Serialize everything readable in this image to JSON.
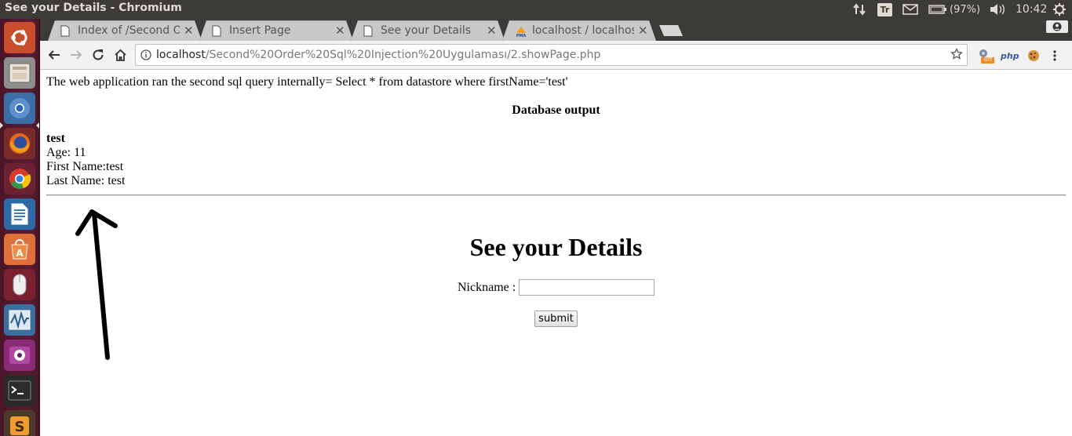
{
  "window": {
    "title": "See your Details - Chromium"
  },
  "system_tray": {
    "keyboard_indicator": "Tr",
    "battery": "(97%)",
    "clock": "10:42"
  },
  "launcher": {
    "items": [
      "ubuntu-logo-icon",
      "files-icon",
      "chromium-icon",
      "firefox-icon",
      "chrome-icon",
      "libreoffice-writer-icon",
      "software-center-icon",
      "mouse-settings-icon",
      "system-monitor-icon",
      "media-player-icon",
      "terminal-icon",
      "sublime-text-icon"
    ]
  },
  "browser": {
    "tabs": [
      {
        "label": "Index of /Second O",
        "icon": "page-icon",
        "active": false
      },
      {
        "label": "Insert Page",
        "icon": "page-icon",
        "active": false
      },
      {
        "label": "See your Details",
        "icon": "page-icon",
        "active": true
      },
      {
        "label": "localhost / localhos",
        "icon": "phpmyadmin-icon",
        "active": false
      }
    ],
    "address": {
      "host": "localhost",
      "path": "/Second%20Order%20Sql%20Injection%20Uygulaması/2.showPage.php"
    },
    "extensions": {
      "cookie_ext_badge": "off",
      "php_ext_label": "php"
    }
  },
  "page": {
    "query_line": "The web application ran the second sql query internally= Select * from datastore where firstName='test'",
    "db_output_title": "Database output",
    "record": {
      "name": "test",
      "age": "Age: 11",
      "first_name": "First Name:test",
      "last_name": "Last Name: test"
    },
    "form": {
      "title": "See your Details",
      "nickname_label": "Nickname :",
      "nickname_value": "",
      "submit_label": "submit"
    }
  },
  "colors": {
    "panel_bg": "#3c3b37",
    "launcher_bg": "#5a1d33",
    "tab_active": "#f2f2f2",
    "tab_inactive": "#c8c8c8"
  }
}
